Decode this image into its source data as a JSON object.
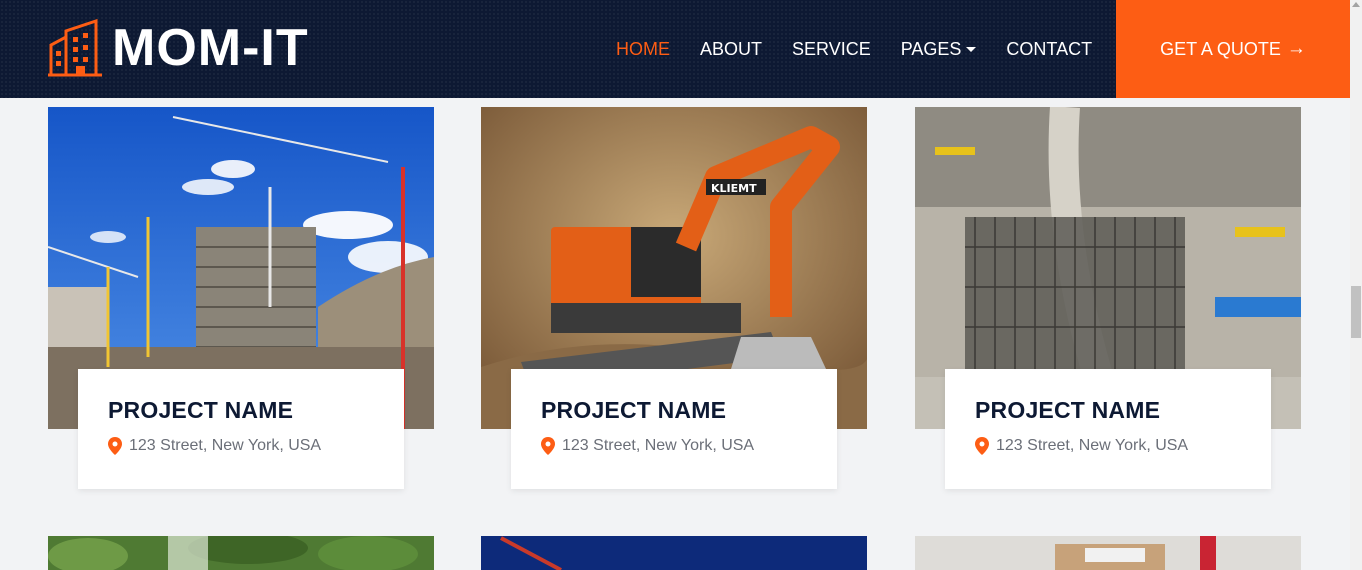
{
  "header": {
    "brand": "MOM-IT",
    "nav": [
      {
        "label": "HOME",
        "active": true
      },
      {
        "label": "ABOUT",
        "active": false
      },
      {
        "label": "SERVICE",
        "active": false
      },
      {
        "label": "PAGES",
        "active": false,
        "dropdown": true
      },
      {
        "label": "CONTACT",
        "active": false
      }
    ],
    "cta": {
      "label": "GET A QUOTE",
      "icon": "arrow-right-icon"
    }
  },
  "colors": {
    "accent": "#fd5d14",
    "navy": "#0d1933",
    "background": "#f2f3f5"
  },
  "projects": [
    {
      "name": "PROJECT NAME",
      "address": "123 Street, New York, USA",
      "image": "high-rise-construction-with-cranes"
    },
    {
      "name": "PROJECT NAME",
      "address": "123 Street, New York, USA",
      "image": "orange-excavator-on-sand"
    },
    {
      "name": "PROJECT NAME",
      "address": "123 Street, New York, USA",
      "image": "rebar-foundation-site"
    },
    {
      "image": "trees"
    },
    {
      "image": "night-crane"
    },
    {
      "image": "modular-building-with-crane"
    }
  ]
}
